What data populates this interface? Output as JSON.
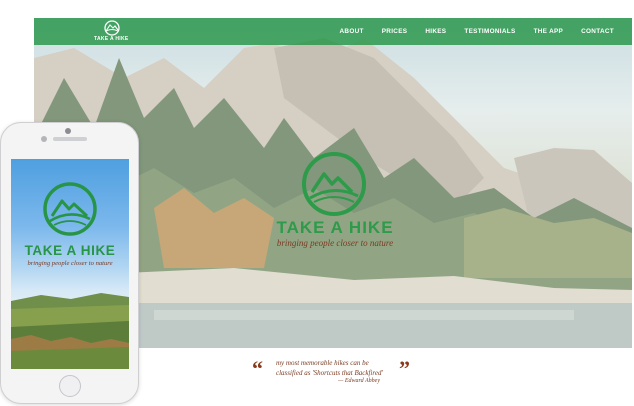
{
  "site": {
    "logo_text": "TAKE A HIKE",
    "nav": [
      {
        "label": "ABOUT"
      },
      {
        "label": "PRICES"
      },
      {
        "label": "HIKES"
      },
      {
        "label": "TESTIMONIALS"
      },
      {
        "label": "THE APP"
      },
      {
        "label": "CONTACT"
      }
    ],
    "hero": {
      "title": "TAKE A HIKE",
      "tagline": "bringing people closer to nature"
    },
    "testimonial": {
      "open_mark": "“",
      "close_mark": "”",
      "text": "my most memorable hikes can be classified as 'Shortcuts that Backfired'",
      "author": "— Edward Abbey"
    }
  },
  "phone": {
    "title": "TAKE A HIKE",
    "tagline": "bringing people closer to nature"
  },
  "colors": {
    "brand_green": "#2e9b4a",
    "accent_brown": "#7a3b22",
    "nav_bg": "#269648"
  },
  "icons": {
    "brand_logo": "mountain-circle-logo",
    "phone_home": "home-button"
  }
}
